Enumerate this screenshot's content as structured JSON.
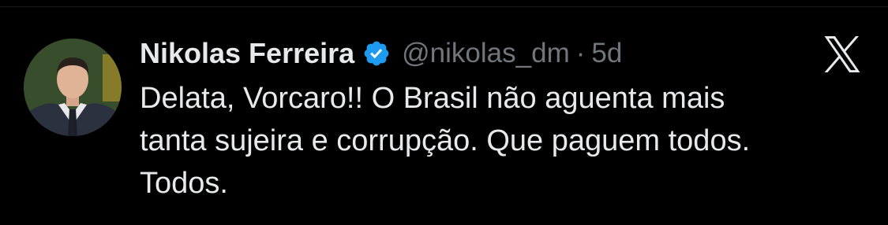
{
  "author": {
    "name": "Nikolas Ferreira",
    "handle": "@nikolas_dm",
    "separator": "·",
    "time": "5d",
    "verified_icon": "verified-badge-icon",
    "avatar_icon": "profile-photo"
  },
  "tweet": {
    "lines": [
      "Delata, Vorcaro!! O Brasil não aguenta mais",
      "tanta sujeira e corrupção. Que paguem todos.",
      "Todos."
    ]
  },
  "brand": {
    "logo_icon": "x-logo-icon"
  },
  "colors": {
    "background": "#000000",
    "primary_text": "#e7e9ea",
    "secondary_text": "#71767b",
    "verified_blue": "#1d9bf0"
  }
}
